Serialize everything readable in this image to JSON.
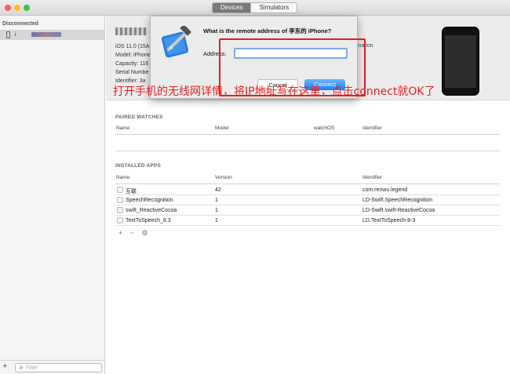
{
  "window": {
    "tabs": [
      {
        "label": "Devices",
        "active": true
      },
      {
        "label": "Simulators",
        "active": false
      }
    ]
  },
  "sidebar": {
    "header": "Disconnected",
    "device_label": "i",
    "filter_placeholder": "Filter",
    "add_label": "+"
  },
  "device": {
    "info": [
      "iOS 11.0 (15A",
      "Model: iPhone",
      "Capacity: 116",
      "Serial Numbe",
      "Identifier: 3a"
    ],
    "destination_fragment": "ination"
  },
  "paired_watches": {
    "title": "PAIRED WATCHES",
    "columns": [
      "Name",
      "Model",
      "watchOS",
      "Identifier"
    ]
  },
  "installed_apps": {
    "title": "INSTALLED APPS",
    "columns": [
      "Name",
      "Version",
      "Identifier"
    ],
    "rows": [
      {
        "name": "互联",
        "version": "42",
        "identifier": "com.renwu.legend"
      },
      {
        "name": "SpeechRecognition",
        "version": "1",
        "identifier": "LD-Swift.SpeechRecognition"
      },
      {
        "name": "swift_ReactiveCocoa",
        "version": "1",
        "identifier": "LD-Swift.swift-ReactiveCocoa"
      },
      {
        "name": "TextToSpeech_8.3",
        "version": "1",
        "identifier": "LD.TextToSpeech-8-3"
      }
    ],
    "tools": [
      "+",
      "−",
      "⚙"
    ]
  },
  "dialog": {
    "title": "What is the remote address of 李东的 iPhone?",
    "address_label": "Address:",
    "address_value": "",
    "cancel_label": "Cancel",
    "connect_label": "Connect"
  },
  "annotation": {
    "text": "打开手机的无线网详情，将IP地址写在这里，点击connect就OK了",
    "color": "#ef1d1d"
  },
  "colors": {
    "accent": "#1a82fb",
    "close": "#fc5f57",
    "minimize": "#fdbc2e",
    "zoom": "#33c748"
  }
}
